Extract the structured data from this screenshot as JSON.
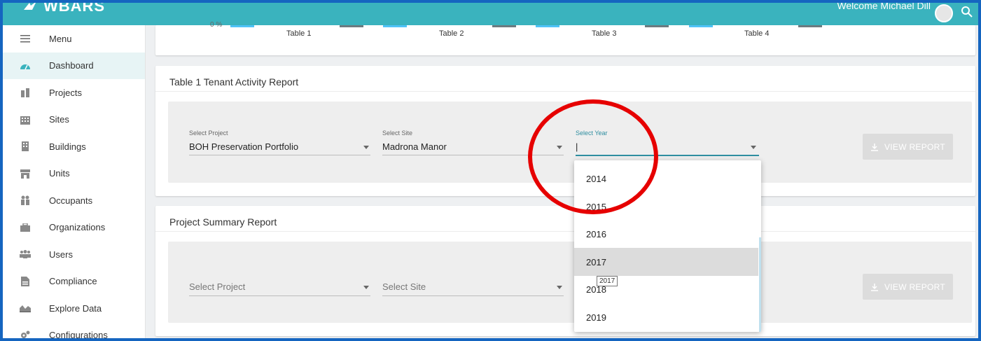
{
  "app": {
    "logo_text": "WBARS",
    "welcome_text": "Welcome Michael Dill"
  },
  "sidebar": {
    "items": [
      {
        "label": "Menu",
        "icon": "menu-icon"
      },
      {
        "label": "Dashboard",
        "icon": "dashboard-icon",
        "active": true
      },
      {
        "label": "Projects",
        "icon": "projects-icon"
      },
      {
        "label": "Sites",
        "icon": "sites-icon"
      },
      {
        "label": "Buildings",
        "icon": "buildings-icon"
      },
      {
        "label": "Units",
        "icon": "units-icon"
      },
      {
        "label": "Occupants",
        "icon": "occupants-icon"
      },
      {
        "label": "Organizations",
        "icon": "organizations-icon"
      },
      {
        "label": "Users",
        "icon": "users-icon"
      },
      {
        "label": "Compliance",
        "icon": "compliance-icon"
      },
      {
        "label": "Explore Data",
        "icon": "explore-data-icon"
      },
      {
        "label": "Configurations",
        "icon": "configurations-icon"
      }
    ]
  },
  "chart": {
    "zero_label": "0 %",
    "ticks": [
      "Table 1",
      "Table 2",
      "Table 3",
      "Table 4"
    ],
    "colors": {
      "primary": "#4fc3f7",
      "secondary": "#6d7b80"
    }
  },
  "tenant_report": {
    "title": "Table 1 Tenant Activity Report",
    "project_label": "Select Project",
    "project_value": "BOH Preservation Portfolio",
    "site_label": "Select Site",
    "site_value": "Madrona Manor",
    "year_label": "Select Year",
    "year_value": "|",
    "button_label": "VIEW REPORT"
  },
  "project_summary": {
    "title": "Project Summary Report",
    "project_placeholder": "Select Project",
    "site_placeholder": "Select Site",
    "button_label": "VIEW REPORT"
  },
  "year_dropdown": {
    "options": [
      "2014",
      "2015",
      "2016",
      "2017",
      "2018",
      "2019"
    ],
    "hovered": "2017",
    "tooltip": "2017"
  },
  "colors": {
    "accent": "#3ab3be",
    "frame": "#1565c0",
    "highlight_circle": "#e60000"
  }
}
